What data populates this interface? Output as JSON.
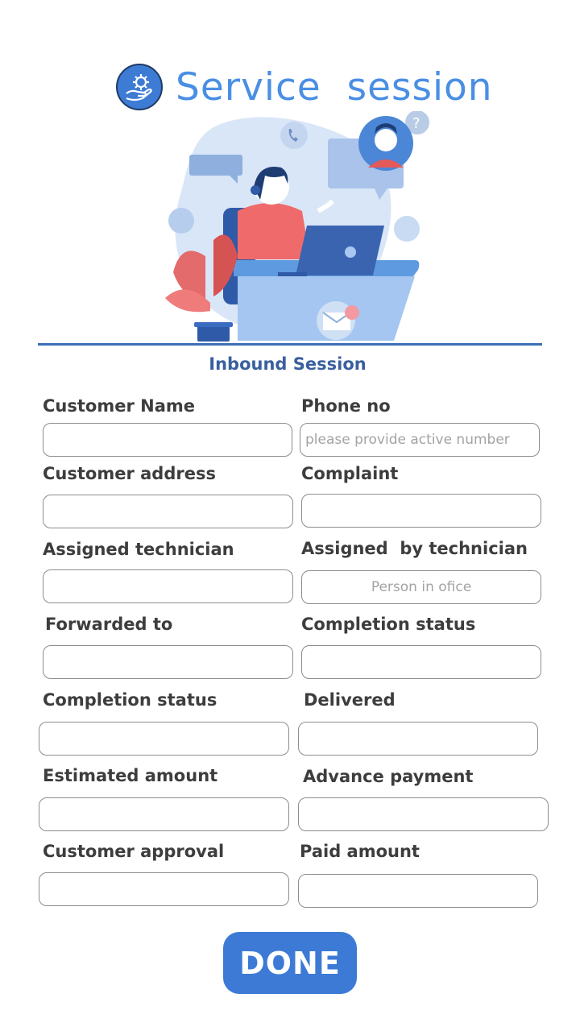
{
  "app": {
    "title": "Service  session"
  },
  "colors": {
    "accent": "#3c7ad6",
    "title": "#4a8fe3",
    "section": "#3a5f9e"
  },
  "illustration": {
    "description_icon": "customer-support-illustration"
  },
  "form": {
    "section_title": "Inbound Session",
    "customer_name": {
      "label": "Customer Name",
      "value": "",
      "placeholder": ""
    },
    "phone_no": {
      "label": "Phone no",
      "value": "",
      "placeholder": "please provide active number"
    },
    "customer_address": {
      "label": "Customer address",
      "value": "",
      "placeholder": ""
    },
    "complaint": {
      "label": "Complaint",
      "value": "",
      "placeholder": ""
    },
    "assigned_technician": {
      "label": "Assigned technician",
      "value": "",
      "placeholder": ""
    },
    "assigned_by_technician": {
      "label": "Assigned  by technician",
      "value": "",
      "placeholder": "Person in ofice"
    },
    "forwarded_to": {
      "label": "Forwarded to",
      "value": "",
      "placeholder": ""
    },
    "completion_status_right": {
      "label": "Completion status",
      "value": "",
      "placeholder": ""
    },
    "completion_status_left": {
      "label": "Completion status",
      "value": "",
      "placeholder": ""
    },
    "delivered": {
      "label": "Delivered",
      "value": "",
      "placeholder": ""
    },
    "estimated_amount": {
      "label": "Estimated amount",
      "value": "",
      "placeholder": ""
    },
    "advance_payment": {
      "label": "Advance payment",
      "value": "",
      "placeholder": ""
    },
    "customer_approval": {
      "label": "Customer approval",
      "value": "",
      "placeholder": ""
    },
    "paid_amount": {
      "label": "Paid amount",
      "value": "",
      "placeholder": ""
    }
  },
  "actions": {
    "done_label": "DONE"
  }
}
